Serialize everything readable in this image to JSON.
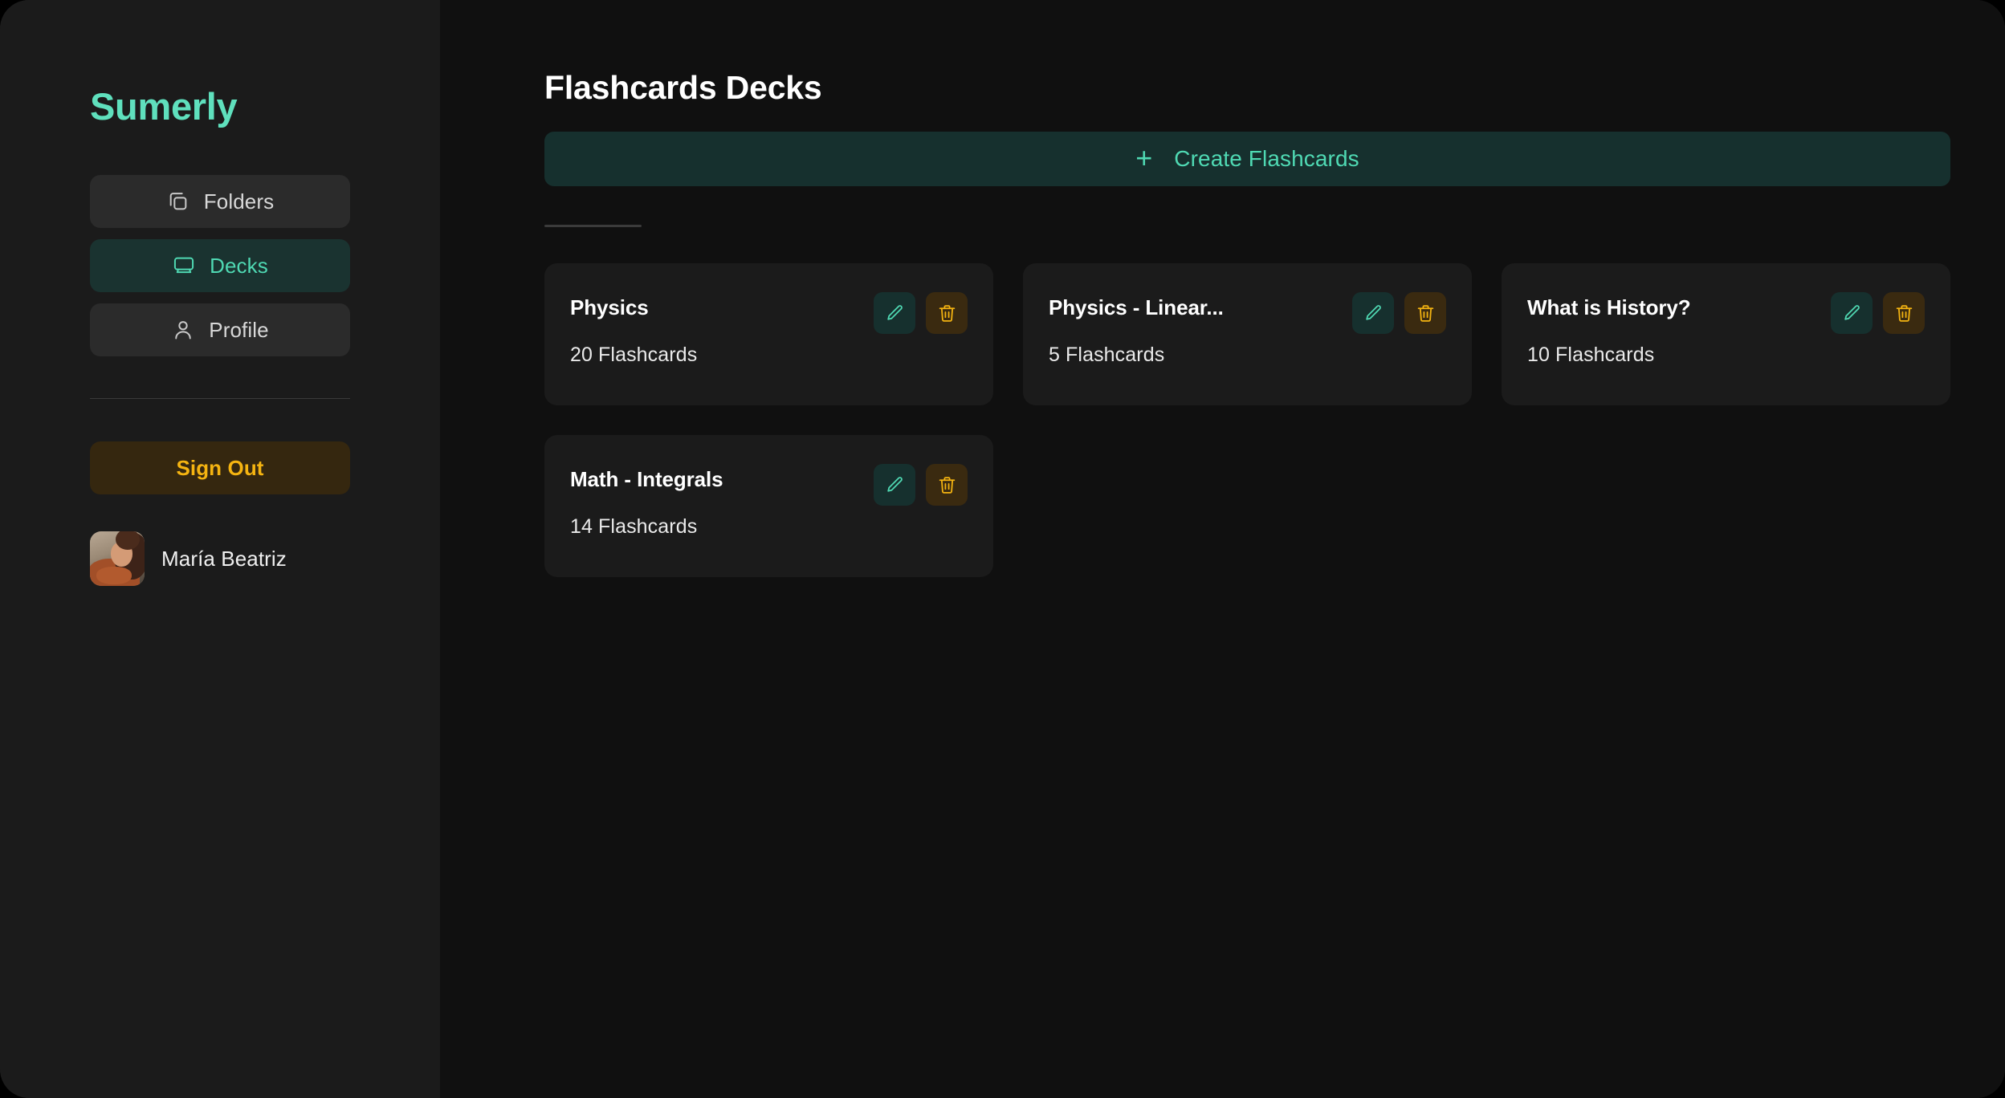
{
  "brand": {
    "name": "Sumerly",
    "color": "#5fe0bd"
  },
  "sidebar": {
    "nav_items": [
      {
        "label": "Folders",
        "icon": "folders-icon",
        "active": false
      },
      {
        "label": "Decks",
        "icon": "monitor-icon",
        "active": true
      },
      {
        "label": "Profile",
        "icon": "person-icon",
        "active": false
      }
    ],
    "sign_out_label": "Sign Out",
    "sign_out_color": "#f5b411",
    "user": {
      "name": "María Beatriz",
      "avatar": "user-photo"
    }
  },
  "main": {
    "page_title": "Flashcards Decks",
    "create_button": {
      "label": "Create Flashcards",
      "icon": "plus-icon",
      "color": "#4fd9b3"
    },
    "decks": [
      {
        "title": "Physics",
        "count_label": "20 Flashcards",
        "edit_icon": "pencil-icon",
        "delete_icon": "trash-icon"
      },
      {
        "title": "Physics - Linear...",
        "count_label": "5 Flashcards",
        "edit_icon": "pencil-icon",
        "delete_icon": "trash-icon"
      },
      {
        "title": "What is History?",
        "count_label": "10 Flashcards",
        "edit_icon": "pencil-icon",
        "delete_icon": "trash-icon"
      },
      {
        "title": "Math - Integrals",
        "count_label": "14 Flashcards",
        "edit_icon": "pencil-icon",
        "delete_icon": "trash-icon"
      }
    ]
  }
}
